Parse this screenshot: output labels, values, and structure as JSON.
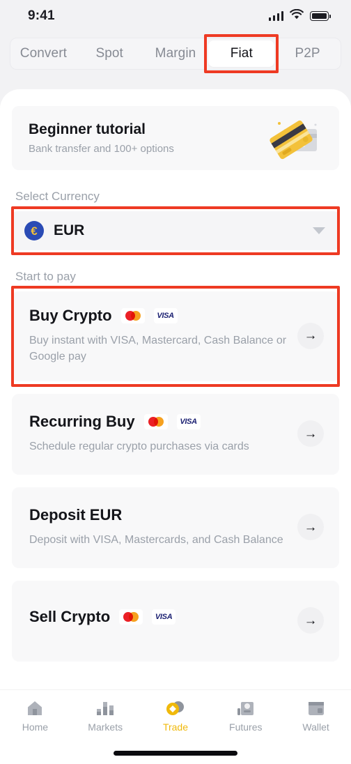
{
  "status_bar": {
    "time": "9:41",
    "signal_icon": "signal-bars-icon",
    "wifi_icon": "wifi-icon",
    "battery_icon": "battery-icon"
  },
  "tabs": [
    {
      "label": "Convert",
      "active": false
    },
    {
      "label": "Spot",
      "active": false
    },
    {
      "label": "Margin",
      "active": false
    },
    {
      "label": "Fiat",
      "active": true
    },
    {
      "label": "P2P",
      "active": false
    }
  ],
  "tutorial": {
    "title": "Beginner tutorial",
    "subtitle": "Bank transfer and 100+ options",
    "icon": "credit-cards-illustration"
  },
  "currency_section": {
    "label": "Select Currency",
    "selected_code": "EUR",
    "selected_symbol": "€",
    "caret_icon": "chevron-down-icon"
  },
  "pay_section": {
    "label": "Start to pay"
  },
  "cards": [
    {
      "title": "Buy Crypto",
      "description": "Buy instant with VISA, Mastercard, Cash Balance or Google pay",
      "payments": [
        "mastercard",
        "visa"
      ],
      "arrow_icon": "arrow-right-icon",
      "highlighted": true
    },
    {
      "title": "Recurring Buy",
      "description": "Schedule regular crypto purchases via cards",
      "payments": [
        "mastercard",
        "visa"
      ],
      "arrow_icon": "arrow-right-icon",
      "highlighted": false
    },
    {
      "title": "Deposit EUR",
      "description": "Deposit with VISA, Mastercards, and Cash Balance",
      "payments": [],
      "arrow_icon": "arrow-right-icon",
      "highlighted": false
    },
    {
      "title": "Sell Crypto",
      "description": "",
      "payments": [
        "mastercard",
        "visa"
      ],
      "arrow_icon": "arrow-right-icon",
      "highlighted": false
    }
  ],
  "visa_label": "VISA",
  "arrow_glyph": "→",
  "bottom_nav": [
    {
      "label": "Home",
      "icon": "home-icon",
      "active": false
    },
    {
      "label": "Markets",
      "icon": "bar-chart-icon",
      "active": false
    },
    {
      "label": "Trade",
      "icon": "coins-icon",
      "active": true
    },
    {
      "label": "Futures",
      "icon": "futures-icon",
      "active": false
    },
    {
      "label": "Wallet",
      "icon": "wallet-icon",
      "active": false
    }
  ],
  "colors": {
    "annotation": "#ee3a23",
    "accent": "#f0b90b",
    "text_primary": "#14151a",
    "text_muted": "#9aa0a9",
    "card_bg": "#f8f8f9"
  }
}
